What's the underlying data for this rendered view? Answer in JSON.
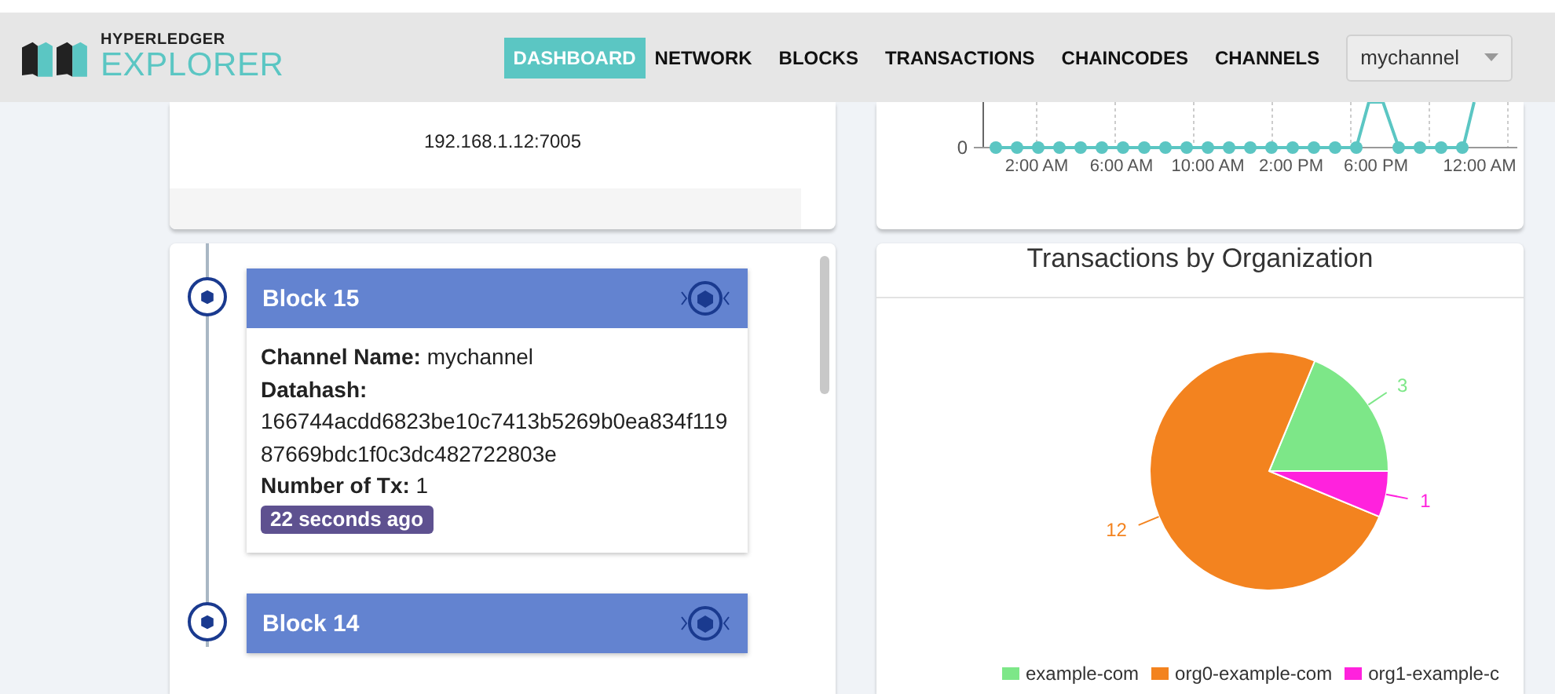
{
  "header": {
    "logo": {
      "line1": "HYPERLEDGER",
      "line2": "EXPLORER"
    },
    "nav": [
      {
        "label": "DASHBOARD",
        "selected": true
      },
      {
        "label": "NETWORK",
        "selected": false
      },
      {
        "label": "BLOCKS",
        "selected": false
      },
      {
        "label": "TRANSACTIONS",
        "selected": false
      },
      {
        "label": "CHAINCODES",
        "selected": false
      },
      {
        "label": "CHANNELS",
        "selected": false
      }
    ],
    "channel_select": {
      "value": "mychannel"
    }
  },
  "peer_card": {
    "address": "192.168.1.12:7005"
  },
  "tx_chart": {
    "y_tick": "0",
    "x_labels": [
      "2:00 AM",
      "6:00 AM",
      "10:00 AM",
      "2:00 PM",
      "6:00 PM",
      "12:00 AM"
    ]
  },
  "blocks": [
    {
      "title": "Block 15",
      "expanded": true,
      "channel_label": "Channel Name:",
      "channel": "mychannel",
      "datahash_label": "Datahash:",
      "datahash": "166744acdd6823be10c7413b5269b0ea834f11987669bdc1f0c3dc482722803e",
      "tx_label": "Number of Tx:",
      "tx": "1",
      "age": "22 seconds ago"
    },
    {
      "title": "Block 14",
      "expanded": false
    }
  ],
  "org_chart": {
    "chart_data": {
      "type": "pie",
      "title": "Transactions by Organization",
      "categories": [
        "example-com",
        "org0-example-com",
        "org1-example-c"
      ],
      "series": [
        {
          "values": [
            3,
            12,
            1
          ]
        }
      ],
      "colors": [
        "#7de788",
        "#f3831f",
        "#ff22dd"
      ],
      "data_labels": true
    }
  }
}
